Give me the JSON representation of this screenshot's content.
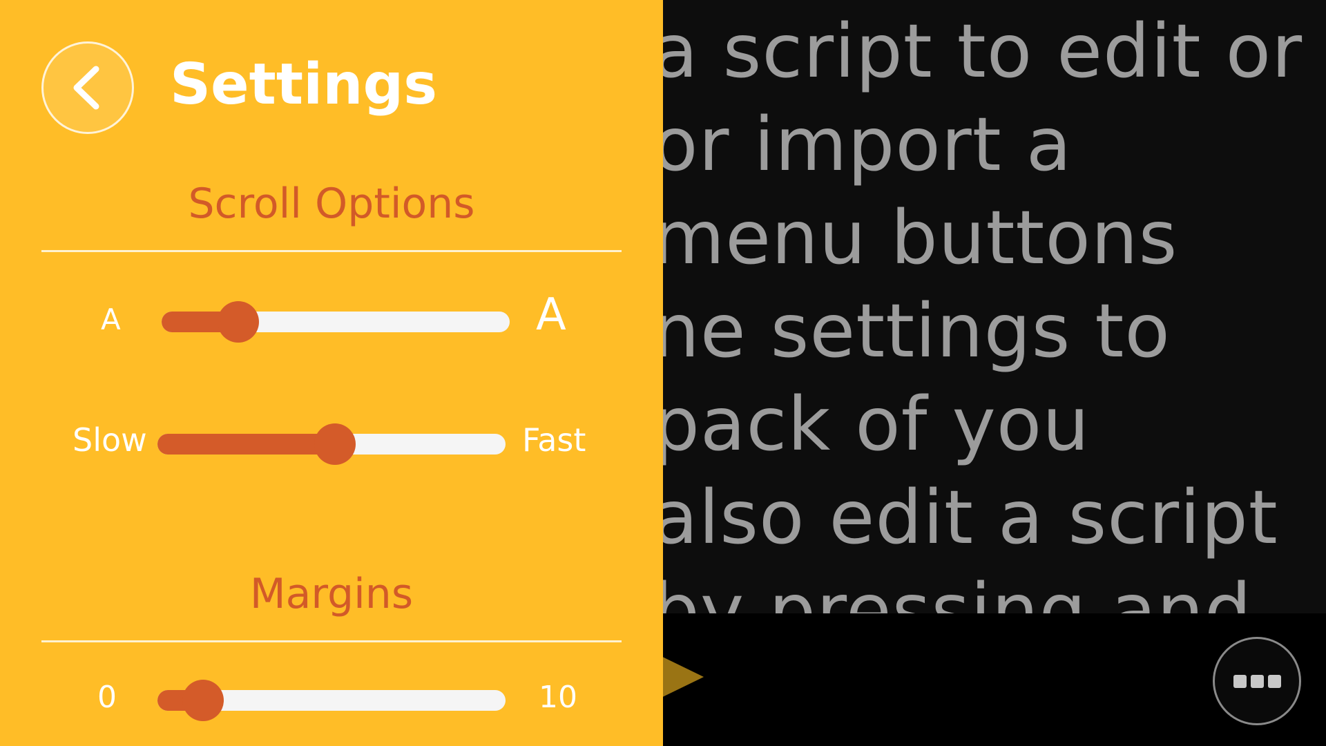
{
  "script_text": {
    "lines": [
      "a script to edit or",
      " or import a",
      "menu buttons",
      "ne settings to",
      "pack of you",
      "also edit a script",
      "by pressing and"
    ]
  },
  "settings": {
    "title": "Settings",
    "back_icon": "chevron-left-icon",
    "scroll_options": {
      "heading": "Scroll Options",
      "font_size": {
        "min_label": "A",
        "max_label": "A",
        "value": 0.22
      },
      "speed": {
        "min_label": "Slow",
        "max_label": "Fast",
        "value": 0.51
      }
    },
    "margins": {
      "heading": "Margins",
      "min_label": "0",
      "max_label": "10",
      "value": 0.13
    }
  },
  "player": {
    "play_icon": "play-icon",
    "more_icon": "more-icon"
  },
  "colors": {
    "panel": "#ffbd27",
    "accent": "#d45b29",
    "script_text": "#9c9c9c",
    "background": "#0d0d0d"
  }
}
